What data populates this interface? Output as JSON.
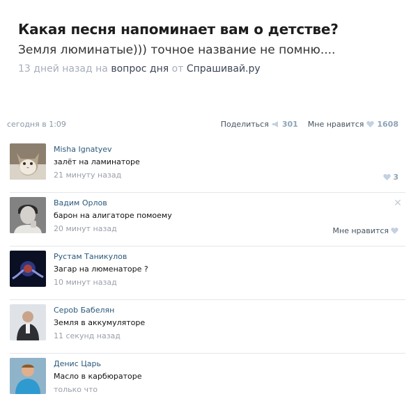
{
  "question": {
    "title": "Какая песня напоминает вам о детстве?",
    "answer": "Земля люминатые))) точное название не помню....",
    "meta_time": "13 дней назад",
    "meta_on": "на",
    "meta_link": "вопрос дня",
    "meta_from": "от",
    "meta_source": "Спрашивай.ру"
  },
  "stats": {
    "time": "сегодня в 1:09",
    "share_label": "Поделиться",
    "share_count": "301",
    "like_label": "Мне нравится",
    "like_count": "1608"
  },
  "comments": [
    {
      "author": "Misha Ignatyev",
      "text": "залёт на ламинаторе",
      "time": "21 минуту назад",
      "likes": "3"
    },
    {
      "author": "Вадим Орлов",
      "text": "барон на алигаторе помоему",
      "time": "20 минут назад",
      "like_label": "Мне нравится"
    },
    {
      "author": "Рустам Таникулов",
      "text": "Загар на люменаторе ?",
      "time": "10 минут назад"
    },
    {
      "author": "Серob Бабелян",
      "text": "Земля в аккумуляторе",
      "time": "11 секунд назад"
    },
    {
      "author": "Денис Царь",
      "text": "Масло в карбюраторе",
      "time": "только что"
    }
  ],
  "colors": {
    "link": "#2b587a",
    "meta": "#a6aebb",
    "heart": "#c3d1e0"
  }
}
